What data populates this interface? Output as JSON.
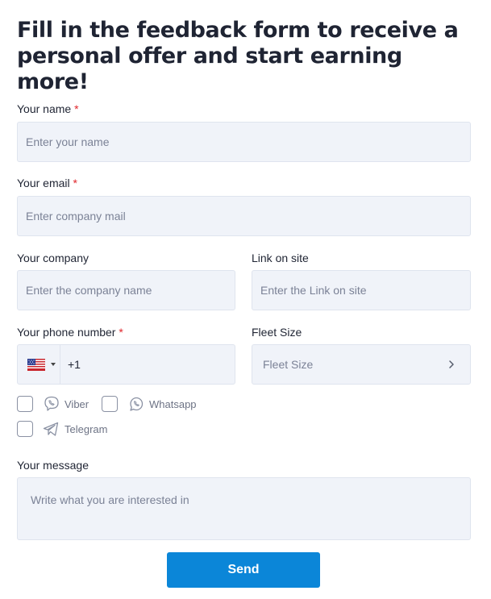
{
  "form": {
    "title": "Fill in the feedback form to receive a personal offer and start earning more!",
    "required_mark": "*",
    "name": {
      "label": "Your name",
      "placeholder": "Enter your name"
    },
    "email": {
      "label": "Your email",
      "placeholder": "Enter company mail"
    },
    "company": {
      "label": "Your company",
      "placeholder": "Enter the company name"
    },
    "link": {
      "label": "Link on site",
      "placeholder": "Enter the Link on site"
    },
    "phone": {
      "label": "Your phone number",
      "country_icon": "us-flag-icon",
      "value": "+1"
    },
    "fleet": {
      "label": "Fleet Size",
      "value": "Fleet Size",
      "icon": "chevron-right-icon"
    },
    "messengers": [
      {
        "label": "Viber",
        "icon": "viber-icon",
        "checked": false
      },
      {
        "label": "Whatsapp",
        "icon": "whatsapp-icon",
        "checked": false
      },
      {
        "label": "Telegram",
        "icon": "telegram-icon",
        "checked": false
      }
    ],
    "message": {
      "label": "Your message",
      "placeholder": "Write what you are interested in"
    },
    "send_label": "Send"
  },
  "colors": {
    "accent": "#0b86d8",
    "field_bg": "#f0f3f9",
    "required": "#e0252b"
  }
}
